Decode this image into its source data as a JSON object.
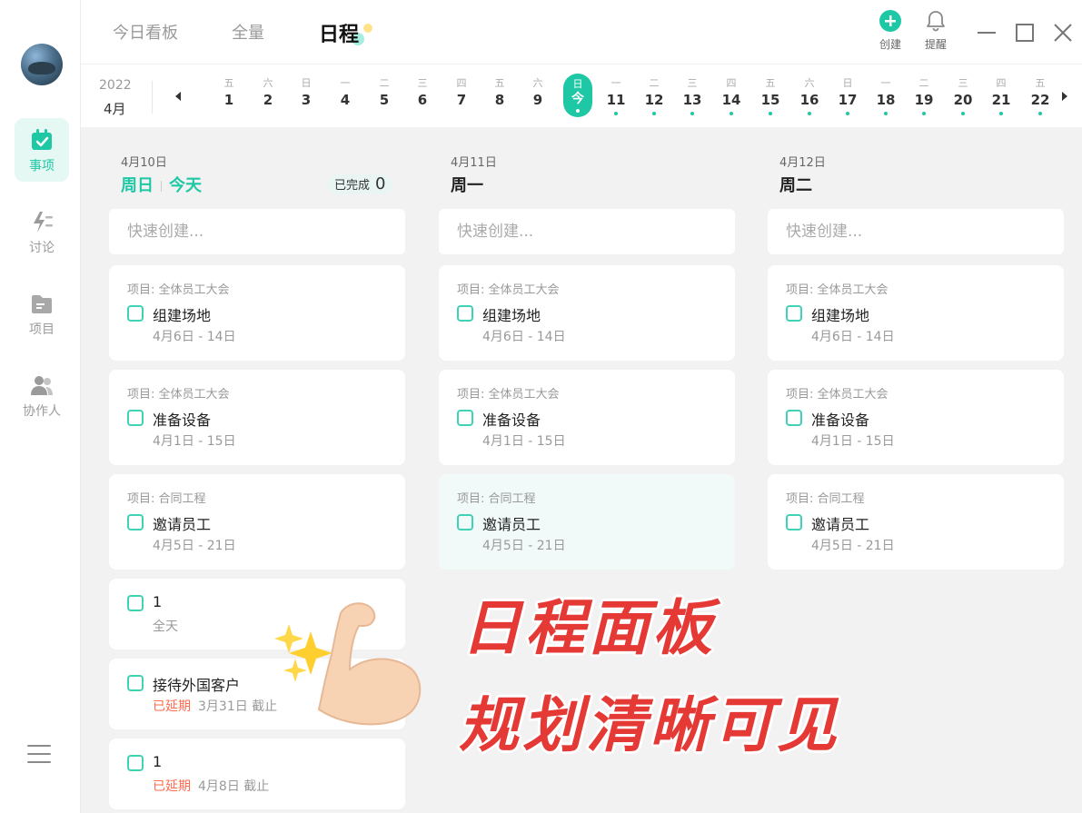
{
  "sidebar": {
    "items": [
      {
        "label": "事项",
        "active": true
      },
      {
        "label": "讨论",
        "active": false
      },
      {
        "label": "项目",
        "active": false
      },
      {
        "label": "协作人",
        "active": false
      }
    ]
  },
  "header": {
    "tabs": [
      {
        "label": "今日看板"
      },
      {
        "label": "全量"
      },
      {
        "label": "日程"
      }
    ],
    "actions": {
      "create_label": "创建",
      "remind_label": "提醒"
    }
  },
  "datestrip": {
    "year": "2022",
    "month": "4月",
    "days": [
      {
        "wd": "五",
        "dn": "1"
      },
      {
        "wd": "六",
        "dn": "2"
      },
      {
        "wd": "日",
        "dn": "3"
      },
      {
        "wd": "一",
        "dn": "4"
      },
      {
        "wd": "二",
        "dn": "5"
      },
      {
        "wd": "三",
        "dn": "6"
      },
      {
        "wd": "四",
        "dn": "7"
      },
      {
        "wd": "五",
        "dn": "8"
      },
      {
        "wd": "六",
        "dn": "9"
      },
      {
        "wd": "日",
        "dn": "今"
      },
      {
        "wd": "一",
        "dn": "11"
      },
      {
        "wd": "二",
        "dn": "12"
      },
      {
        "wd": "三",
        "dn": "13"
      },
      {
        "wd": "四",
        "dn": "14"
      },
      {
        "wd": "五",
        "dn": "15"
      },
      {
        "wd": "六",
        "dn": "16"
      },
      {
        "wd": "日",
        "dn": "17"
      },
      {
        "wd": "一",
        "dn": "18"
      },
      {
        "wd": "二",
        "dn": "19"
      },
      {
        "wd": "三",
        "dn": "20"
      },
      {
        "wd": "四",
        "dn": "21"
      },
      {
        "wd": "五",
        "dn": "22"
      }
    ]
  },
  "columns": [
    {
      "date": "4月10日",
      "day": "周日",
      "today_label": "今天",
      "done_label": "已完成",
      "done_count": "0",
      "quick_placeholder": "快速创建...",
      "cards": [
        {
          "proj": "项目: 全体员工大会",
          "title": "组建场地",
          "sub": "4月6日 - 14日"
        },
        {
          "proj": "项目: 全体员工大会",
          "title": "准备设备",
          "sub": "4月1日 - 15日"
        },
        {
          "proj": "项目: 合同工程",
          "title": "邀请员工",
          "sub": "4月5日 - 21日"
        },
        {
          "title": "1",
          "sub": "全天"
        },
        {
          "title": "接待外国客户",
          "overdue": "已延期",
          "sub": "3月31日 截止"
        },
        {
          "title": "1",
          "overdue": "已延期",
          "sub": "4月8日 截止"
        }
      ]
    },
    {
      "date": "4月11日",
      "day": "周一",
      "quick_placeholder": "快速创建...",
      "cards": [
        {
          "proj": "项目: 全体员工大会",
          "title": "组建场地",
          "sub": "4月6日 - 14日"
        },
        {
          "proj": "项目: 全体员工大会",
          "title": "准备设备",
          "sub": "4月1日 - 15日"
        },
        {
          "proj": "项目: 合同工程",
          "title": "邀请员工",
          "sub": "4月5日 - 21日"
        }
      ]
    },
    {
      "date": "4月12日",
      "day": "周二",
      "quick_placeholder": "快速创建...",
      "cards": [
        {
          "proj": "项目: 全体员工大会",
          "title": "组建场地",
          "sub": "4月6日 - 14日"
        },
        {
          "proj": "项目: 全体员工大会",
          "title": "准备设备",
          "sub": "4月1日 - 15日"
        },
        {
          "proj": "项目: 合同工程",
          "title": "邀请员工",
          "sub": "4月5日 - 21日"
        }
      ]
    }
  ],
  "promo": {
    "line1": "日程面板",
    "line2": "规划清晰可见"
  },
  "colors": {
    "accent": "#1ec8a5",
    "overdue": "#ff6a4d",
    "promo": "#e53935"
  }
}
